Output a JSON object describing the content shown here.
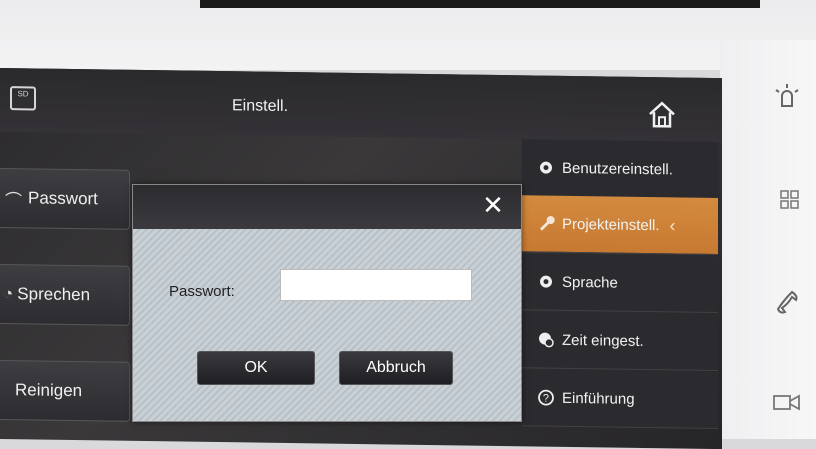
{
  "header": {
    "title": "Einstell.",
    "sd_label": "SD"
  },
  "left_buttons": [
    {
      "label": "Passwort"
    },
    {
      "label": "Sprechen"
    },
    {
      "label": "Reinigen"
    }
  ],
  "sidebar": {
    "items": [
      {
        "label": "Benutzereinstell.",
        "icon": "gear-icon"
      },
      {
        "label": "Projekteinstell.",
        "icon": "wrench-icon",
        "active": true
      },
      {
        "label": "Sprache",
        "icon": "gear-icon"
      },
      {
        "label": "Zeit eingest.",
        "icon": "clock-gear-icon"
      },
      {
        "label": "Einführung",
        "icon": "help-icon"
      }
    ]
  },
  "dialog": {
    "password_label": "Passwort:",
    "password_value": "",
    "ok_label": "OK",
    "cancel_label": "Abbruch"
  },
  "colors": {
    "accent": "#c97b33",
    "panel": "#2b2a2e"
  }
}
